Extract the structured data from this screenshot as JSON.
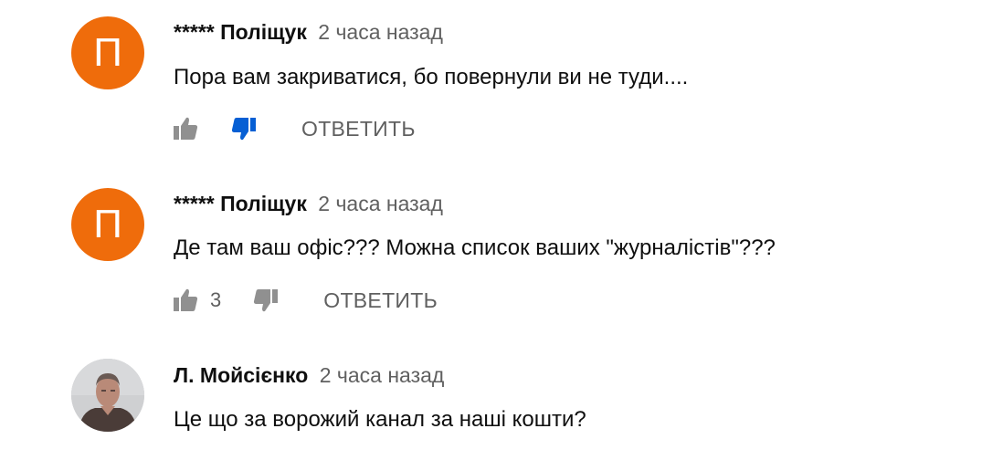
{
  "comments": [
    {
      "avatar_letter": "П",
      "author": "***** Поліщук",
      "time": "2 часа назад",
      "text": "Пора вам закриватися, бо повернули ви не туди....",
      "likes": "",
      "disliked": true,
      "reply_label": "ОТВЕТИТЬ"
    },
    {
      "avatar_letter": "П",
      "author": "***** Поліщук",
      "time": "2 часа назад",
      "text": "Де там ваш офіс??? Можна список ваших \"журналістів\"???",
      "likes": "3",
      "disliked": false,
      "reply_label": "ОТВЕТИТЬ"
    },
    {
      "avatar_letter": "",
      "author": "Л. Мойсієнко",
      "time": "2 часа назад",
      "text": "Це що за ворожий канал за наші кошти?"
    }
  ],
  "colors": {
    "avatar_orange": "#ef6c0b",
    "dislike_active": "#065fd4",
    "icon_inactive": "#909090"
  }
}
